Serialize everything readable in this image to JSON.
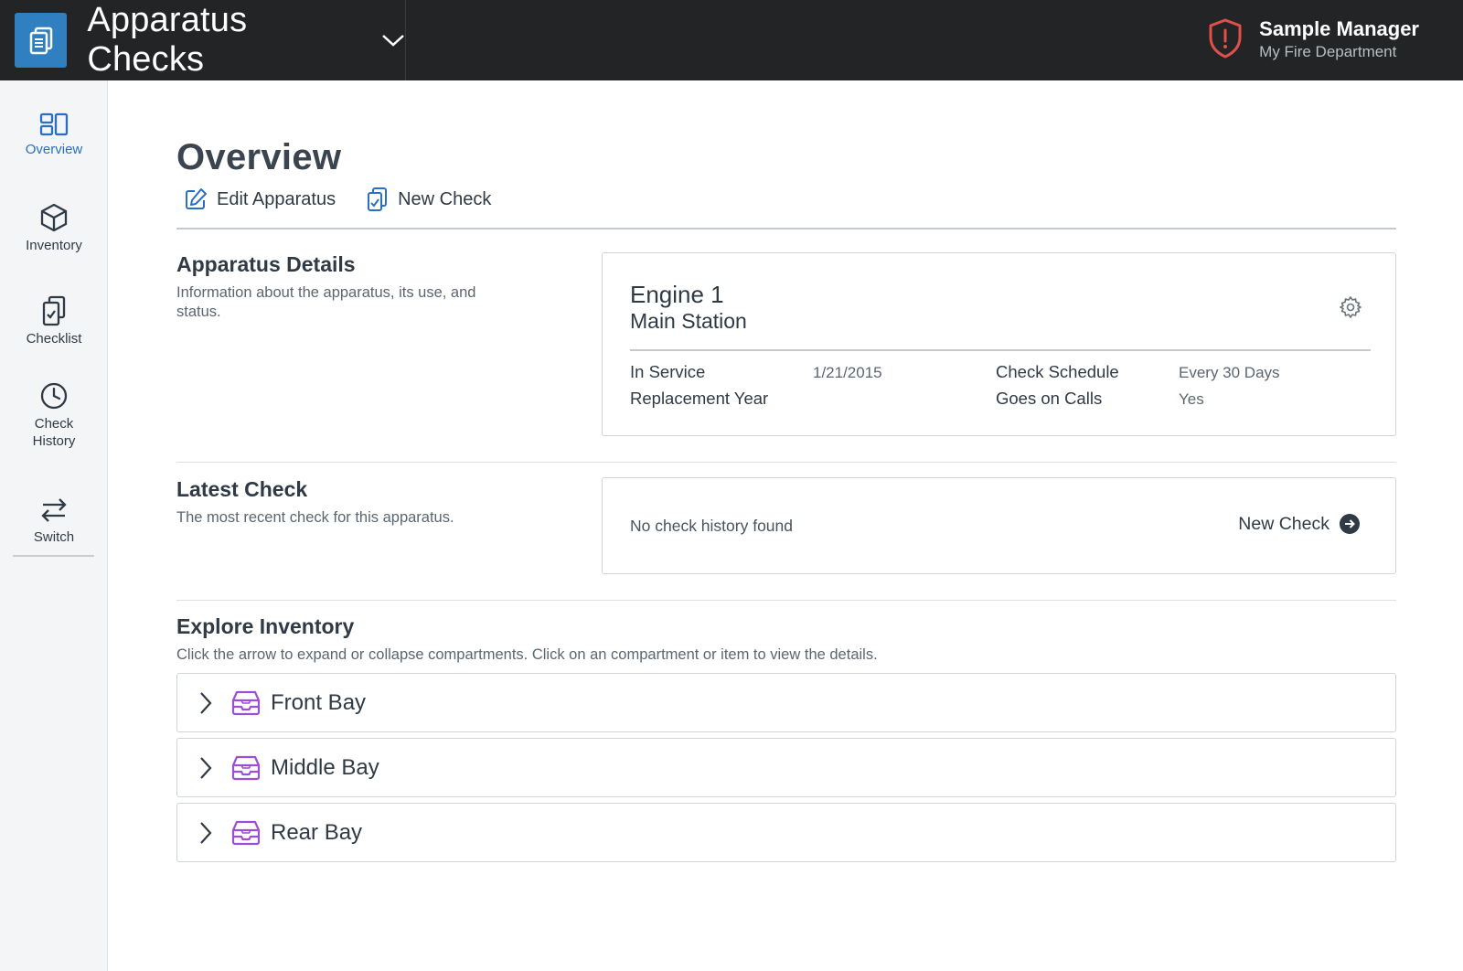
{
  "header": {
    "app_title": "Apparatus Checks",
    "user_name": "Sample Manager",
    "department": "My Fire Department"
  },
  "sidebar": {
    "items": [
      {
        "label": "Overview",
        "icon": "overview-icon",
        "active": true
      },
      {
        "label": "Inventory",
        "icon": "cube-icon"
      },
      {
        "label": "Checklist",
        "icon": "clipboard-check-icon"
      },
      {
        "label": "Check History",
        "icon": "clock-icon"
      },
      {
        "label": "Switch",
        "icon": "swap-arrows-icon"
      }
    ]
  },
  "page": {
    "title": "Overview",
    "actions": {
      "edit_label": "Edit Apparatus",
      "new_check_label": "New Check"
    }
  },
  "details": {
    "heading": "Apparatus Details",
    "description": "Information about the apparatus, its use, and status.",
    "apparatus_name": "Engine 1",
    "station": "Main Station",
    "fields": {
      "in_service_label": "In Service",
      "in_service_value": "1/21/2015",
      "replacement_year_label": "Replacement Year",
      "replacement_year_value": "",
      "check_schedule_label": "Check Schedule",
      "check_schedule_value": "Every 30 Days",
      "goes_on_calls_label": "Goes on Calls",
      "goes_on_calls_value": "Yes"
    }
  },
  "latest_check": {
    "heading": "Latest Check",
    "description": "The most recent check for this apparatus.",
    "empty_text": "No check history found",
    "new_check_label": "New Check"
  },
  "inventory": {
    "heading": "Explore Inventory",
    "description": "Click the arrow to expand or collapse compartments. Click on an compartment or item to view the details.",
    "compartments": [
      {
        "label": "Front Bay"
      },
      {
        "label": "Middle Bay"
      },
      {
        "label": "Rear Bay"
      }
    ]
  },
  "colors": {
    "accent_blue": "#2a6fc4",
    "compartment_purple": "#9b4fd6",
    "alert_red": "#e2504a",
    "topbar": "#222426"
  }
}
